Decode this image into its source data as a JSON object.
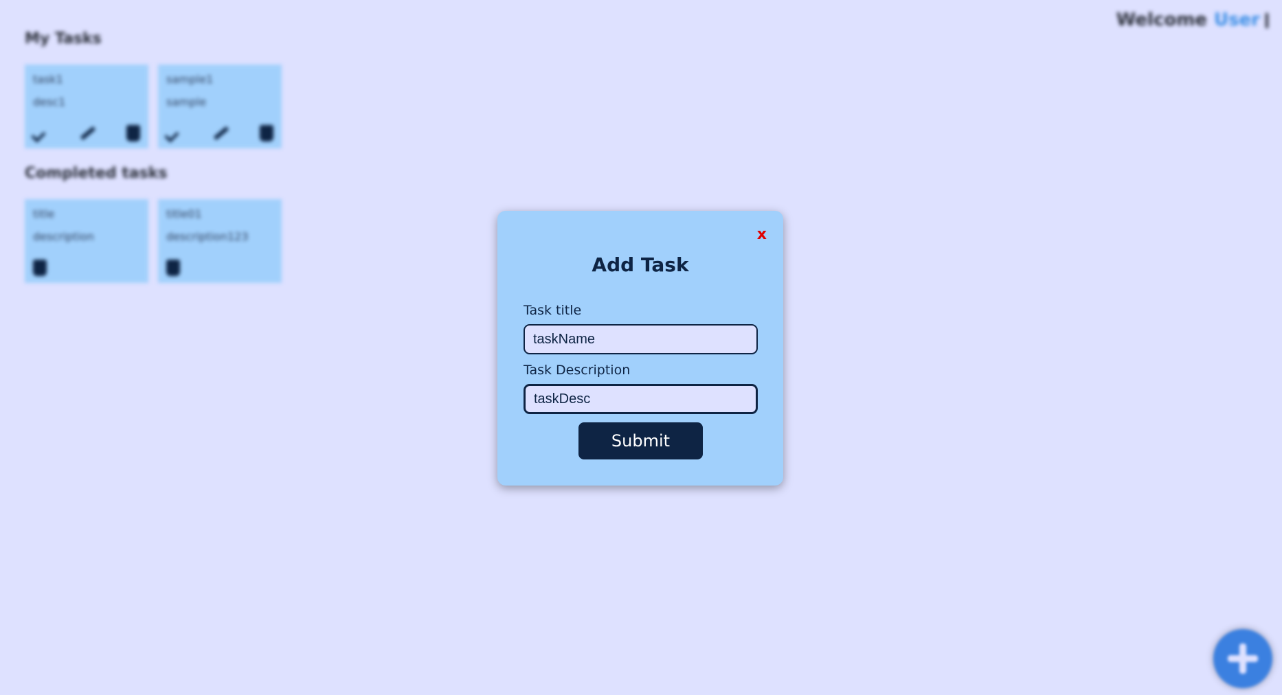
{
  "header": {
    "welcome_text": "Welcome",
    "user_name": "User",
    "logout_icon": "logout-icon"
  },
  "my_tasks": {
    "title": "My Tasks",
    "items": [
      {
        "title": "task1",
        "description": "desc1"
      },
      {
        "title": "sample1",
        "description": "sample"
      }
    ]
  },
  "completed_tasks": {
    "title": "Completed tasks",
    "items": [
      {
        "title": "title",
        "description": "description"
      },
      {
        "title": "title01",
        "description": "description123"
      }
    ]
  },
  "fab": {
    "icon": "plus-icon"
  },
  "modal": {
    "close_label": "x",
    "title": "Add Task",
    "task_title_label": "Task title",
    "task_title_value": "taskName",
    "task_desc_label": "Task Description",
    "task_desc_value": "taskDesc",
    "submit_label": "Submit"
  },
  "colors": {
    "background": "#dee1ff",
    "card": "#a1d0fc",
    "primary_dark": "#0e2444",
    "close_red": "#e00000",
    "fab_blue": "#3b80e0",
    "user_accent": "#3a8ee6"
  }
}
